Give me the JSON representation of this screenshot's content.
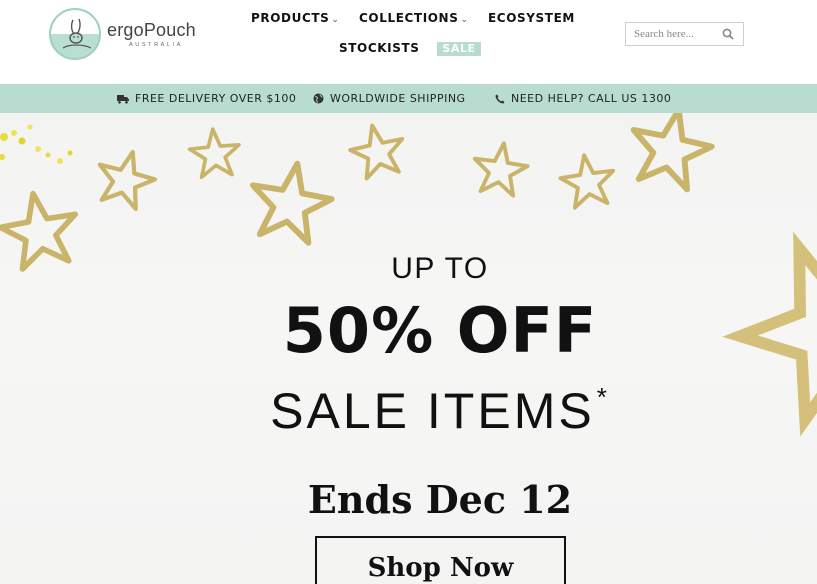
{
  "brand": {
    "name": "ergoPouch",
    "region": "AUSTRALIA"
  },
  "nav": {
    "products": "PRODUCTS",
    "collections": "COLLECTIONS",
    "ecosystem": "ECOSYSTEM",
    "stockists": "STOCKISTS",
    "sale": "SALE"
  },
  "search": {
    "placeholder": "Search here..."
  },
  "infobar": {
    "delivery": "FREE DELIVERY OVER $100",
    "shipping": "WORLDWIDE SHIPPING",
    "help": "NEED HELP? CALL US 1300"
  },
  "hero": {
    "line1": "UP TO",
    "line2": "50% OFF",
    "line3": "SALE ITEMS",
    "asterisk": "*",
    "ends": "Ends Dec 12",
    "cta": "Shop Now"
  },
  "colors": {
    "accent": "#b8ddd0",
    "star_gold": "#c9b46a"
  },
  "icons": [
    "truck-icon",
    "globe-icon",
    "phone-icon",
    "search-icon",
    "chevron-down-icon"
  ]
}
